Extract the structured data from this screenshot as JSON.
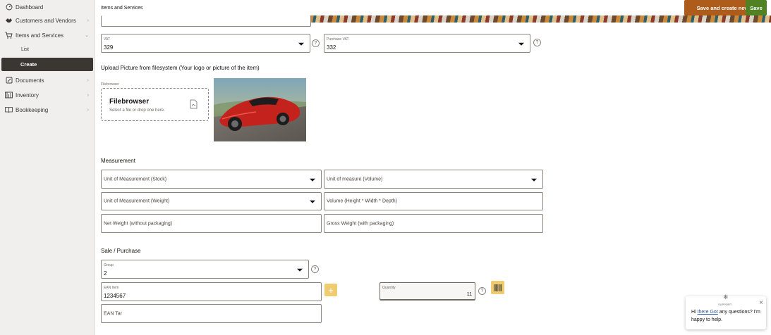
{
  "sidebar": {
    "items": [
      {
        "label": "Dashboard",
        "icon": "dashboard-icon"
      },
      {
        "label": "Customers and Vendors",
        "icon": "handshake-icon"
      },
      {
        "label": "Items and Services",
        "icon": "cart-icon"
      },
      {
        "label": "Documents",
        "icon": "document-icon"
      },
      {
        "label": "Inventory",
        "icon": "inventory-icon"
      },
      {
        "label": "Bookkeeping",
        "icon": "book-icon"
      }
    ],
    "sub_items": [
      {
        "label": "List"
      },
      {
        "label": "Create"
      }
    ]
  },
  "header": {
    "breadcrumb": "Items and Services",
    "save_and_create_new_label": "Save and create new",
    "save_label": "Save"
  },
  "tax": {
    "vat": {
      "label": "VAT",
      "value": "329"
    },
    "purchase_vat": {
      "label": "Purchase VAT",
      "value": "332"
    }
  },
  "upload": {
    "title": "Upload Picture from filesystem (Your logo or picture of the item)",
    "filebrowser_label": "Filebrowser",
    "filebrowser_title": "Filebrowser",
    "filebrowser_hint": "Select a file or drop one here."
  },
  "measurement": {
    "title": "Measurement",
    "unit_stock": "Unit of Measurement (Stock)",
    "unit_volume": "Unit of measure (Volume)",
    "unit_weight": "Unit of Measurement (Weight)",
    "volume_dims": "Volume (Height * Width * Depth)",
    "net_weight": "Net Weight (without packaging)",
    "gross_weight": "Gross Weight (with packaging)"
  },
  "sale": {
    "title": "Sale / Purchase",
    "group": {
      "label": "Group",
      "value": "2"
    },
    "ean_item": {
      "label": "EAN Item",
      "value": "1234567"
    },
    "quantity": {
      "label": "Quantity",
      "value": "11"
    },
    "ean_tar": "EAN Tar"
  },
  "chat": {
    "brand": "SUPPORT",
    "greeting": "Hi",
    "link_text": "there Got",
    "message_rest": "any questions? I'm happy to help."
  },
  "colors": {
    "accent_orange": "#ae5c1c",
    "accent_green": "#508223",
    "sidebar_active": "#3a3632",
    "yellow_button": "#f0cc71"
  }
}
